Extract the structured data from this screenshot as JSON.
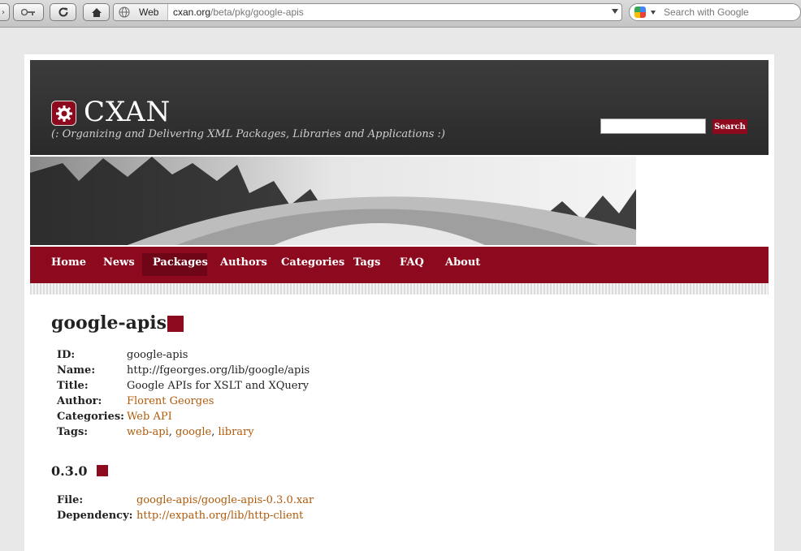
{
  "browser": {
    "url_prefix_label": "Web",
    "url_domain": "cxan.org",
    "url_path": "/beta/pkg/google-apis",
    "search_placeholder": "Search with Google"
  },
  "site": {
    "name": "CXAN",
    "tagline": "(: Organizing and Delivering XML Packages, Libraries and Applications :)",
    "search_button": "Search",
    "accent_color": "#8d0a1e",
    "link_color": "#b05a0a"
  },
  "nav": {
    "items": [
      "Home",
      "News",
      "Packages",
      "Authors",
      "Categories",
      "Tags",
      "FAQ",
      "About"
    ],
    "active": "Packages"
  },
  "package": {
    "title": "google-apis",
    "fields": {
      "id_label": "ID:",
      "id_value": "google-apis",
      "name_label": "Name:",
      "name_value": "http://fgeorges.org/lib/google/apis",
      "title_label": "Title:",
      "title_value": "Google APIs for XSLT and XQuery",
      "author_label": "Author:",
      "author_value": "Florent Georges",
      "categories_label": "Categories:",
      "categories_value": "Web API",
      "tags_label": "Tags:",
      "tags": [
        "web-api",
        "google",
        "library"
      ],
      "tag_sep": ", "
    }
  },
  "version": {
    "title": "0.3.0",
    "file_label": "File:",
    "file_value": "google-apis/google-apis-0.3.0.xar",
    "dependency_label": "Dependency:",
    "dependency_value": "http://expath.org/lib/http-client"
  }
}
